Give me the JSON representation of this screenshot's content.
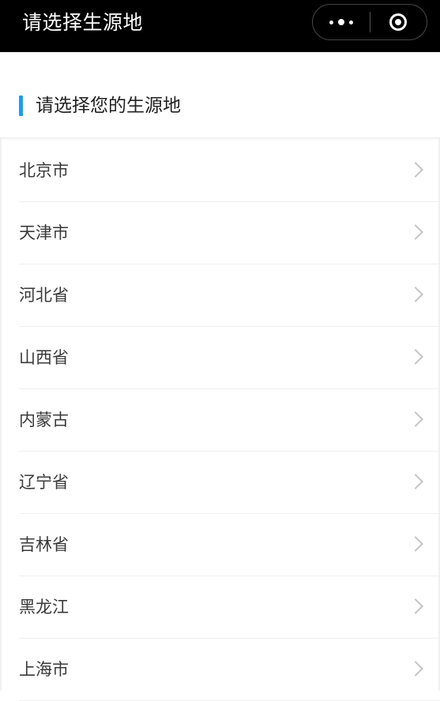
{
  "navbar": {
    "title": "请选择生源地",
    "more_icon": "more-dots-icon",
    "close_icon": "close-target-icon"
  },
  "section": {
    "title": "请选择您的生源地",
    "accent_color": "#1a9ef5"
  },
  "provinces": [
    {
      "label": "北京市"
    },
    {
      "label": "天津市"
    },
    {
      "label": "河北省"
    },
    {
      "label": "山西省"
    },
    {
      "label": "内蒙古"
    },
    {
      "label": "辽宁省"
    },
    {
      "label": "吉林省"
    },
    {
      "label": "黑龙江"
    },
    {
      "label": "上海市"
    }
  ]
}
